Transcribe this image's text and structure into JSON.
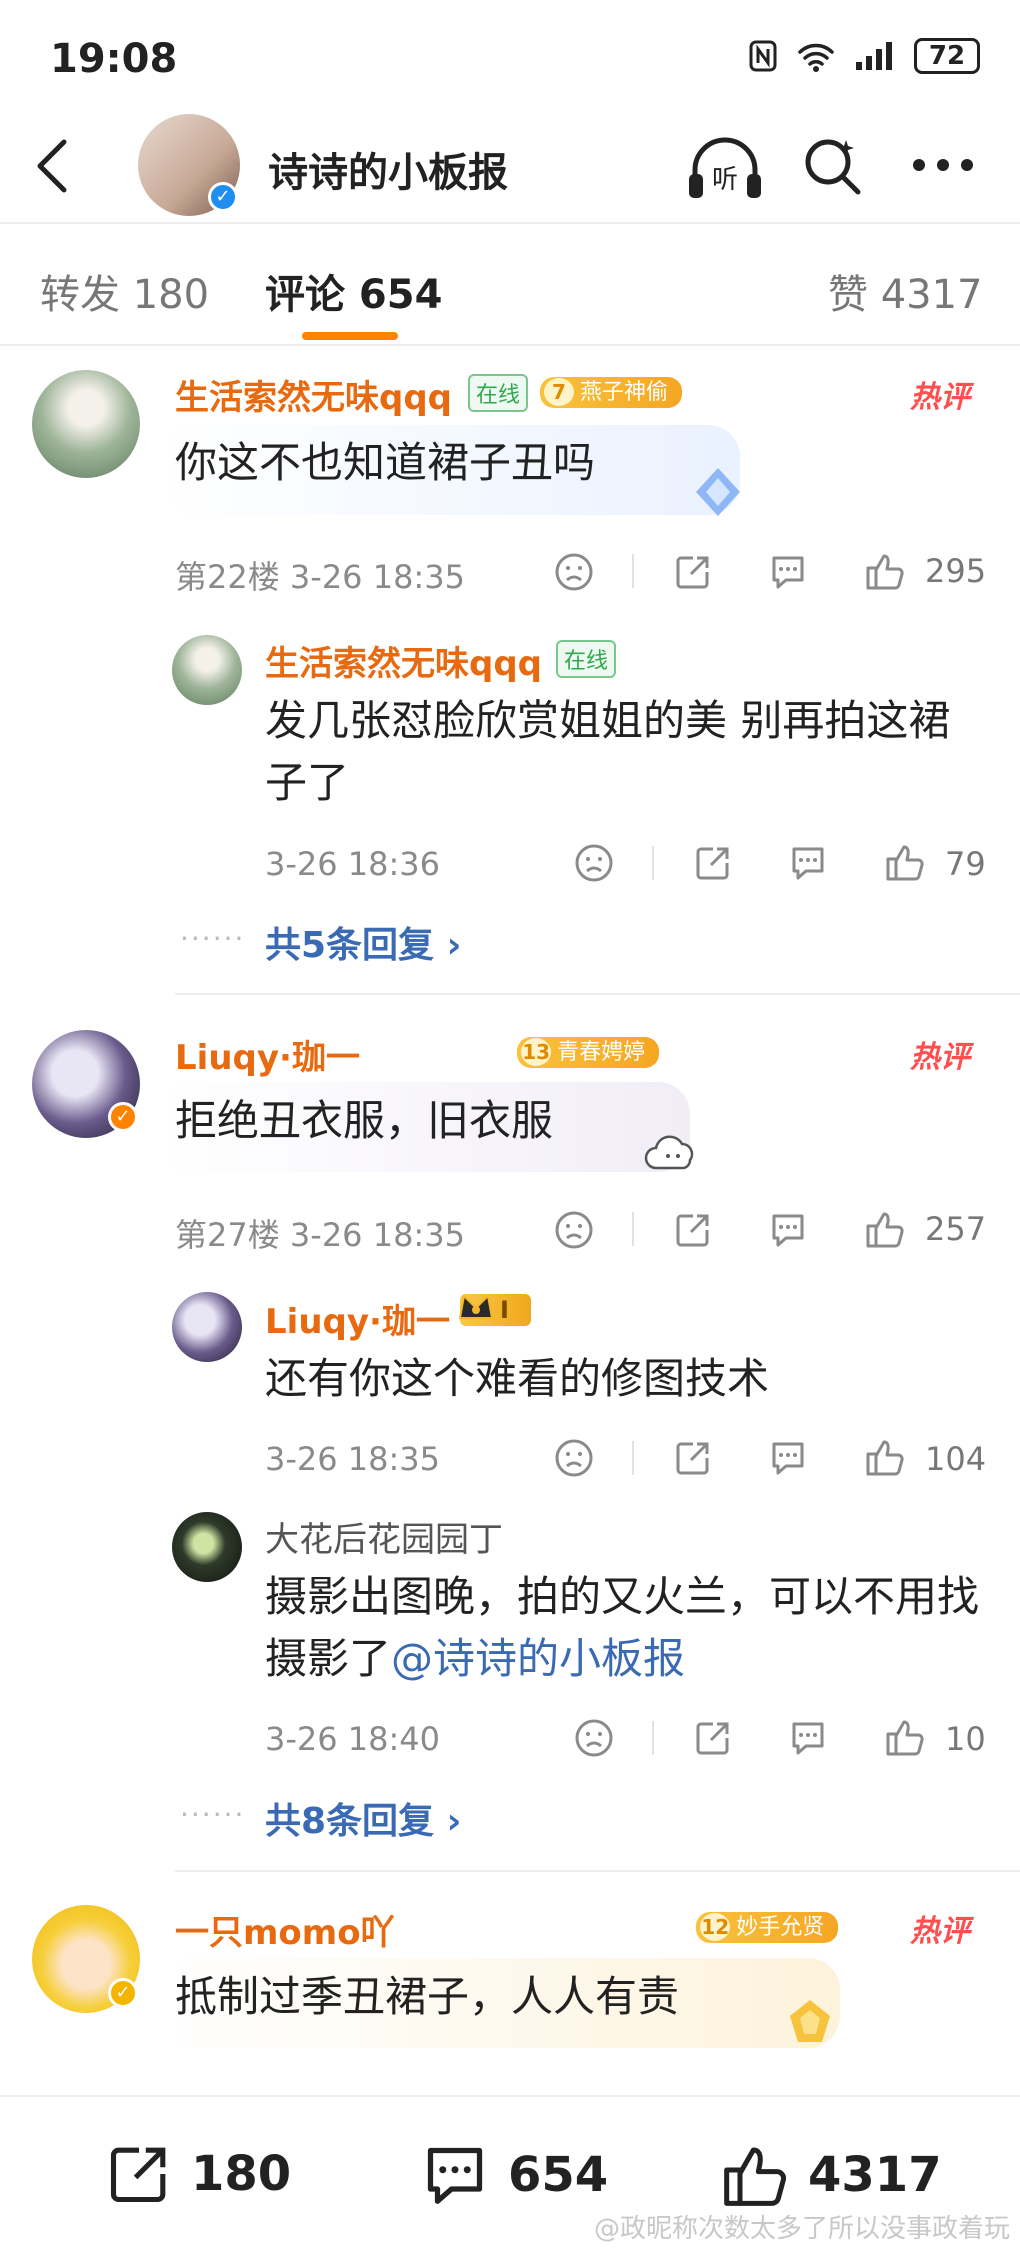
{
  "status_bar": {
    "time": "19:08",
    "battery": "72"
  },
  "header": {
    "title": "诗诗的小板报",
    "verified": "✓"
  },
  "tabs": {
    "repost": "转发 180",
    "comments": "评论 654",
    "likes": "赞 4317"
  },
  "hot_label": "热评",
  "comments": [
    {
      "user": "生活索然无味qqq",
      "online": "在线",
      "fan_level": "7",
      "fan_title": "燕子神偷",
      "text": "你这不也知道裙子丑吗",
      "floor": "第22楼",
      "time": "3-26 18:35",
      "likes": "295",
      "replies": [
        {
          "user": "生活索然无味qqq",
          "online": "在线",
          "text": "发几张怼脸欣赏姐姐的美  别再拍这裙子了",
          "time": "3-26 18:36",
          "likes": "79"
        }
      ],
      "more_replies": "共5条回复"
    },
    {
      "user": "Liuqy·珈一",
      "fan_level": "13",
      "fan_title": "青春娉婷",
      "text": "拒绝丑衣服，旧衣服",
      "floor": "第27楼",
      "time": "3-26 18:35",
      "likes": "257",
      "replies": [
        {
          "user": "Liuqy·珈一",
          "badge": "I",
          "text": "还有你这个难看的修图技术",
          "time": "3-26 18:35",
          "likes": "104"
        },
        {
          "user": "大花后花园园丁",
          "text": "摄影出图晚，拍的又火兰，可以不用找摄影了",
          "mention": "@诗诗的小板报",
          "time": "3-26 18:40",
          "likes": "10"
        }
      ],
      "more_replies": "共8条回复"
    },
    {
      "user": "一只momo吖",
      "fan_level": "12",
      "fan_title": "妙手允贤",
      "text": "抵制过季丑裙子，人人有责"
    }
  ],
  "bottom_bar": {
    "repost": "180",
    "comment": "654",
    "like": "4317"
  },
  "watermark": "@政昵称次数太多了所以没事政着玩",
  "colors": {
    "accent": "#ff8200",
    "username": "#e86a10",
    "link": "#3b6ab4",
    "hot": "#ff4e4e"
  },
  "icons": [
    "back-arrow-icon",
    "listen-icon",
    "search-icon",
    "more-icon",
    "dislike-icon",
    "share-icon",
    "comment-icon",
    "like-icon"
  ]
}
